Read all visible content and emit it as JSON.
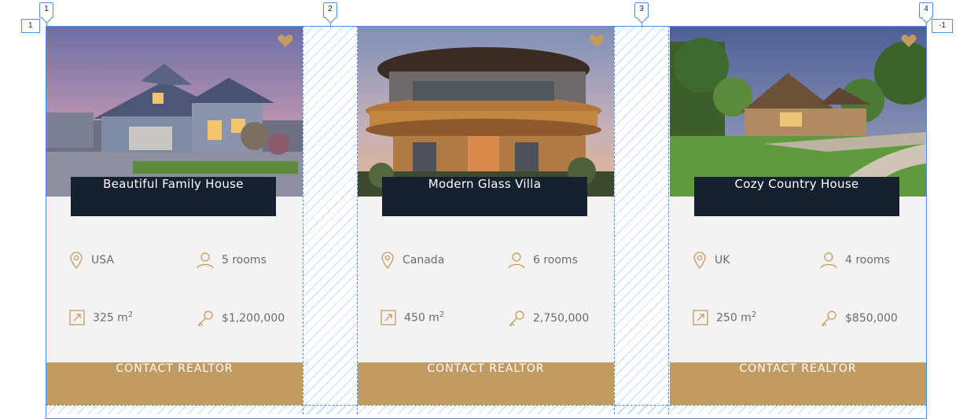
{
  "grid": {
    "column_markers": [
      "1",
      "2",
      "3",
      "4"
    ],
    "row_marker_left": "1",
    "row_marker_right": "-1"
  },
  "colors": {
    "dark": "#152131",
    "accent": "#c29b62",
    "card_bg": "#f5f3f1",
    "grid_line": "#4a90e2"
  },
  "cards": [
    {
      "title": "Beautiful Family House",
      "location": "USA",
      "rooms": "5 rooms",
      "area": "325 m",
      "area_unit_sup": "2",
      "price": "$1,200,000",
      "cta": "CONTACT REALTOR"
    },
    {
      "title": "Modern Glass Villa",
      "location": "Canada",
      "rooms": "6 rooms",
      "area": "450 m",
      "area_unit_sup": "2",
      "price": "2,750,000",
      "cta": "CONTACT REALTOR"
    },
    {
      "title": "Cozy Country House",
      "location": "UK",
      "rooms": "4 rooms",
      "area": "250 m",
      "area_unit_sup": "2",
      "price": "$850,000",
      "cta": "CONTACT REALTOR"
    }
  ],
  "icons": {
    "favorite": "heart-icon",
    "location": "location-pin-icon",
    "rooms": "person-icon",
    "area": "area-icon",
    "price": "key-icon"
  }
}
